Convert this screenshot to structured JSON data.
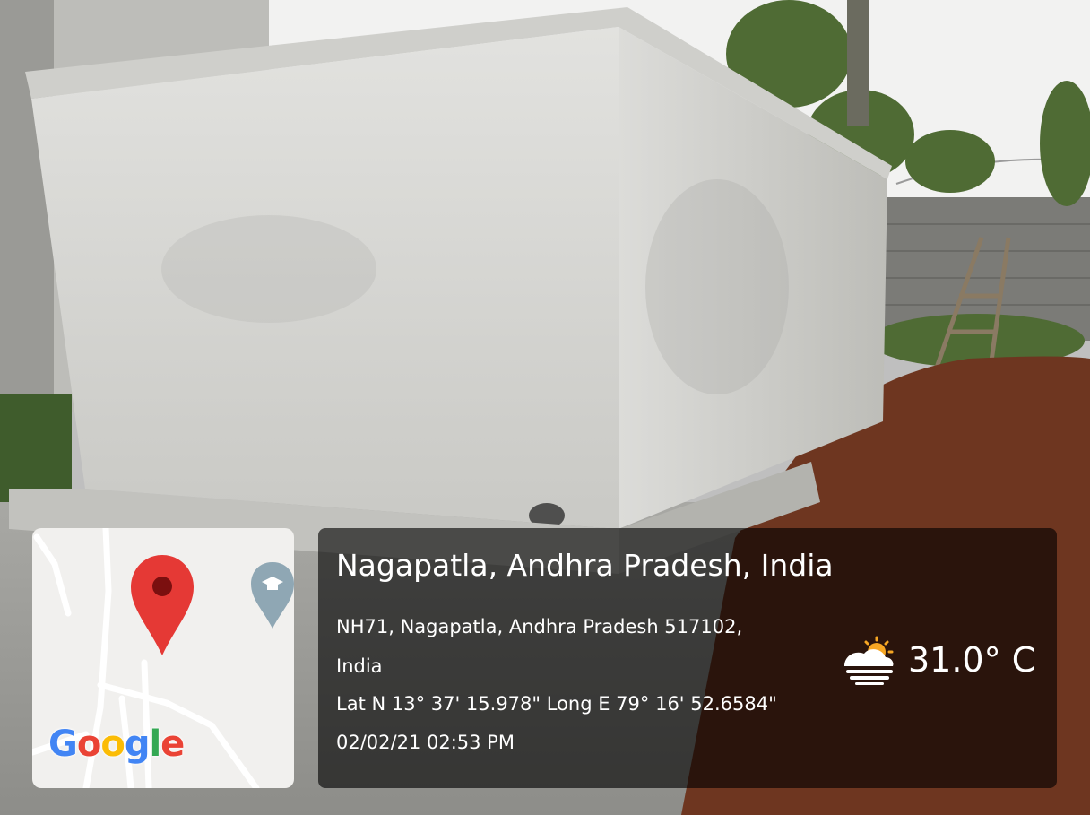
{
  "scene": {
    "subject": "concrete-tank",
    "colors": {
      "wall": "#d8d8d6",
      "soil": "#6e3620",
      "sky": "#f3f3f3",
      "foliage": "#4f6b34",
      "compound_wall": "#7b7b77"
    }
  },
  "map": {
    "pin_icon": "map-pin-icon",
    "poi_icon": "graduation-cap-icon",
    "pin_color": "#e53935",
    "google_logo": "Google"
  },
  "location": {
    "title": "Nagapatla, Andhra Pradesh, India",
    "address_line1": "NH71, Nagapatla, Andhra Pradesh 517102,",
    "address_line2": "India",
    "coordinates": "Lat N 13° 37' 15.978\" Long E 79° 16' 52.6584\"",
    "timestamp": "02/02/21 02:53 PM"
  },
  "weather": {
    "icon": "partly-sunny-icon",
    "temperature": "31.0° C"
  }
}
